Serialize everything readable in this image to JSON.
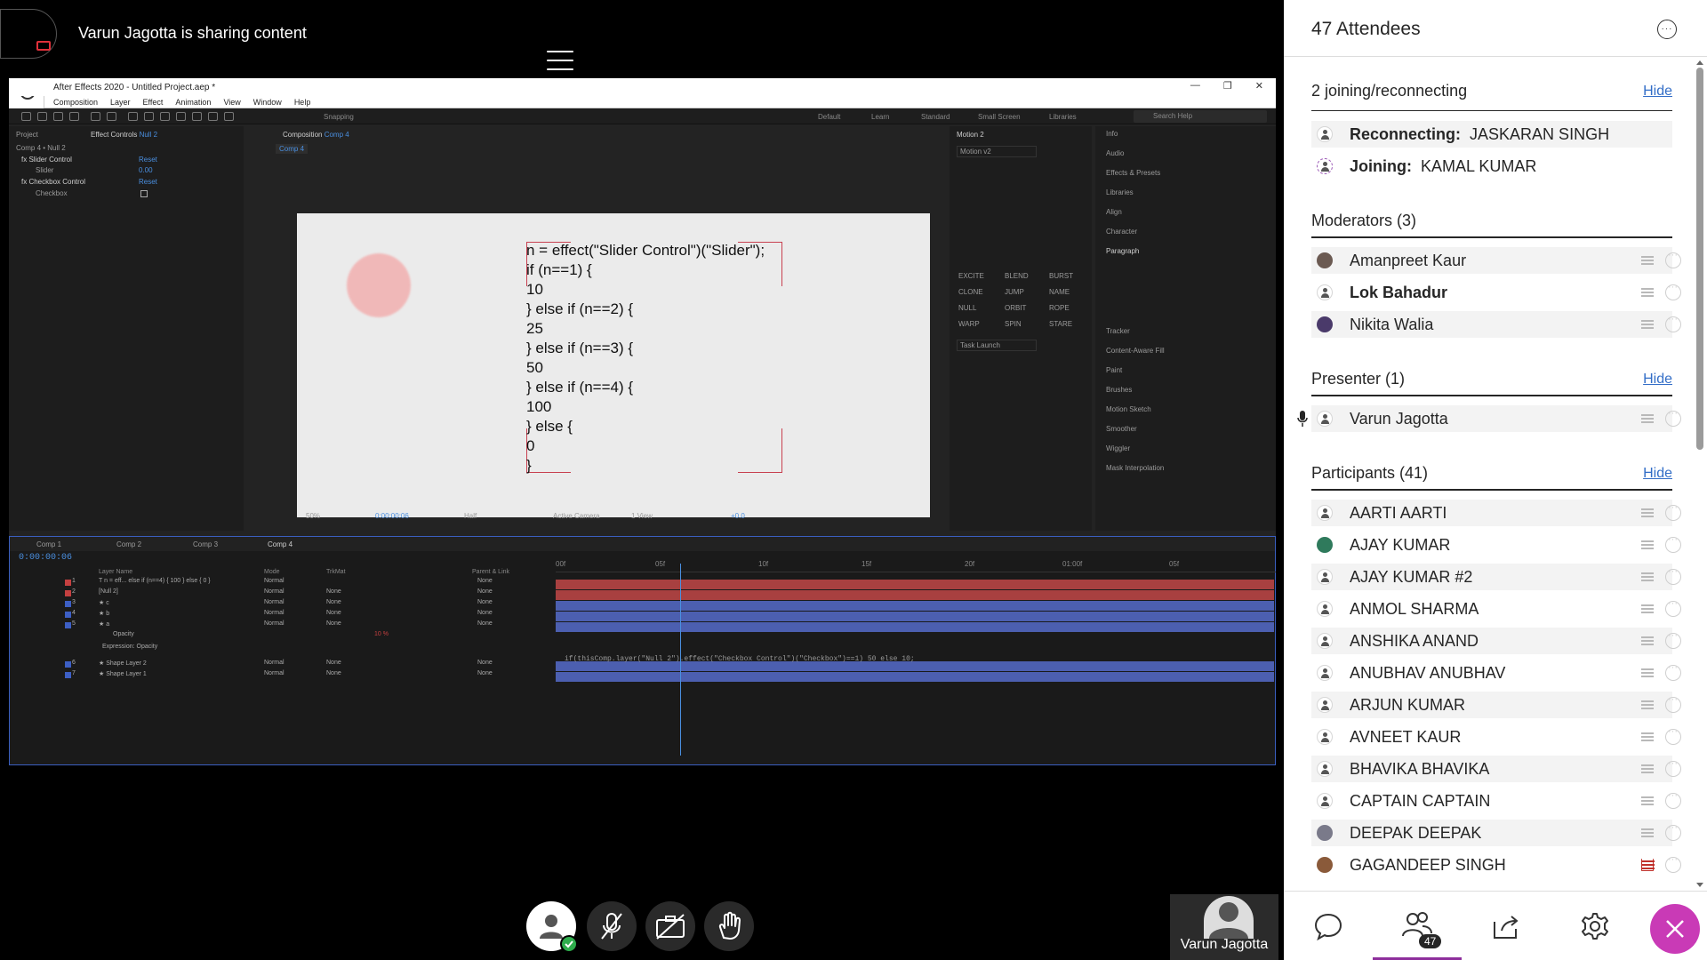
{
  "header": {
    "sharing_text": "Varun Jagotta is sharing content"
  },
  "ae": {
    "title": "After Effects 2020 - Untitled Project.aep *",
    "menu": [
      "Composition",
      "Layer",
      "Effect",
      "Animation",
      "View",
      "Window",
      "Help"
    ],
    "snapping": "Snapping",
    "workspaces": [
      "Default",
      "Learn",
      "Standard",
      "Small Screen",
      "Libraries"
    ],
    "search_help": "Search Help",
    "project_tab": "Project",
    "effect_controls_tab": "Effect Controls",
    "effect_controls_target": "Null 2",
    "ec_header": "Comp 4 • Null 2",
    "effects": [
      {
        "name": "fx Slider Control",
        "value": "Reset"
      },
      {
        "name": "Slider",
        "value": "0.00"
      },
      {
        "name": "fx Checkbox Control",
        "value": "Reset"
      },
      {
        "name": "Checkbox",
        "value": ""
      }
    ],
    "comp_tab": "Composition",
    "comp_tab_name": "Comp 4",
    "comp_breadcrumb": "Comp 4",
    "code_lines": [
      "n = effect(\"Slider Control\")(\"Slider\");",
      "if (n==1) {",
      "10",
      "} else if (n==2) {",
      "25",
      "} else if (n==3) {",
      "50",
      "} else if (n==4) {",
      "100",
      "} else {",
      "0",
      "}"
    ],
    "viewer_bar": {
      "zoom": "50%",
      "timecode": "0:00:00:06",
      "resolution": "Half",
      "camera": "Active Camera",
      "views": "1 View",
      "exposure": "+0.0"
    },
    "motion_panel": {
      "title": "Motion 2",
      "preset": "Motion v2",
      "task": "Task Launch",
      "buttons": [
        "EXCITE",
        "BLEND",
        "BURST",
        "CLONE",
        "JUMP",
        "NAME",
        "NULL",
        "ORBIT",
        "ROPE",
        "WARP",
        "SPIN",
        "STARE"
      ]
    },
    "right_panels": [
      "Info",
      "Audio",
      "Effects & Presets",
      "Libraries",
      "Align",
      "Character",
      "Paragraph",
      "Tracker",
      "Content-Aware Fill",
      "Paint",
      "Brushes",
      "Motion Sketch",
      "Smoother",
      "Wiggler",
      "Mask Interpolation"
    ],
    "timeline": {
      "tabs": [
        "Comp 1",
        "Comp 2",
        "Comp 3",
        "Comp 4"
      ],
      "timecode": "0:00:00:06",
      "ruler": [
        "00f",
        "05f",
        "10f",
        "15f",
        "20f",
        "01:00f",
        "05f"
      ],
      "col_headers": {
        "layer_name": "Layer Name",
        "mode": "Mode",
        "trkmat": "TrkMat",
        "parent": "Parent & Link"
      },
      "layers": [
        {
          "num": "1",
          "name": "T  n = eff... else if (n==4) { 100 } else { 0 }",
          "mode": "Normal",
          "trkmat": "",
          "parent": "None",
          "color": "#c44040"
        },
        {
          "num": "2",
          "name": "[Null 2]",
          "mode": "Normal",
          "trkmat": "None",
          "parent": "None",
          "color": "#c44040"
        },
        {
          "num": "3",
          "name": "★ c",
          "mode": "Normal",
          "trkmat": "None",
          "parent": "None",
          "color": "#3d5fc4"
        },
        {
          "num": "4",
          "name": "★ b",
          "mode": "Normal",
          "trkmat": "None",
          "parent": "None",
          "color": "#3d5fc4"
        },
        {
          "num": "5",
          "name": "★ a",
          "mode": "Normal",
          "trkmat": "None",
          "parent": "None",
          "color": "#3d5fc4"
        }
      ],
      "opacity_label": "Opacity",
      "opacity_value": "10 %",
      "expression_label": "Expression: Opacity",
      "expression": "if(thisComp.layer(\"Null 2\").effect(\"Checkbox Control\")(\"Checkbox\")==1) 50 else 10;",
      "layers_bottom": [
        {
          "num": "6",
          "name": "★ Shape Layer 2",
          "mode": "Normal",
          "trkmat": "None",
          "parent": "None",
          "color": "#3d5fc4"
        },
        {
          "num": "7",
          "name": "★ Shape Layer 1",
          "mode": "Normal",
          "trkmat": "None",
          "parent": "None",
          "color": "#3d5fc4"
        }
      ]
    }
  },
  "presenter_tile": {
    "name": "Varun Jagotta"
  },
  "attendees": {
    "title": "47 Attendees",
    "joining": {
      "title": "2 joining/reconnecting",
      "hide": "Hide",
      "items": [
        {
          "status": "Reconnecting:",
          "name": "JASKARAN SINGH"
        },
        {
          "status": "Joining:",
          "name": "KAMAL KUMAR"
        }
      ]
    },
    "moderators": {
      "title": "Moderators (3)",
      "items": [
        {
          "name": "Amanpreet Kaur",
          "bold": false
        },
        {
          "name": "Lok Bahadur",
          "bold": true
        },
        {
          "name": "Nikita Walia",
          "bold": false
        }
      ]
    },
    "presenter": {
      "title": "Presenter (1)",
      "hide": "Hide",
      "items": [
        {
          "name": "Varun Jagotta"
        }
      ]
    },
    "participants": {
      "title": "Participants (41)",
      "hide": "Hide",
      "items": [
        "AARTI AARTI",
        "AJAY KUMAR",
        "AJAY KUMAR #2",
        "ANMOL SHARMA",
        "ANSHIKA ANAND",
        "ANUBHAV ANUBHAV",
        "ARJUN KUMAR",
        "AVNEET KAUR",
        "BHAVIKA BHAVIKA",
        "CAPTAIN CAPTAIN",
        "DEEPAK DEEPAK",
        "GAGANDEEP SINGH"
      ]
    }
  },
  "bottom_tabs": {
    "attendee_count": "47"
  },
  "colors": {
    "accent": "#8e2f9c",
    "close": "#c93ab6",
    "link": "#336ec7",
    "ok": "#2eac4c"
  }
}
